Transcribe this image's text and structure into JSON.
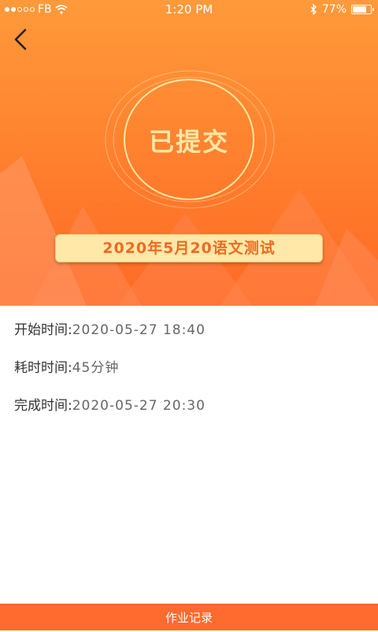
{
  "status_bar": {
    "carrier": "FB",
    "time": "1:20 PM",
    "battery": "77%",
    "battery_level": 0.77,
    "signal_bars": 2
  },
  "header": {
    "back_icon": "chevron-left-icon"
  },
  "submission": {
    "status": "已提交",
    "title": "2020年5月20语文测试"
  },
  "details": {
    "start_label": "开始时间:",
    "start_value": "2020-05-27 18:40",
    "duration_label": "耗时时间:",
    "duration_value": "45分钟",
    "finish_label": "完成时间:",
    "finish_value": "2020-05-27 20:30"
  },
  "footer": {
    "history_button": "作业记录"
  },
  "colors": {
    "accent": "#ff6a2e",
    "hero_top": "#ff9a3a",
    "badge_text": "#ffe7a6",
    "title_bg": "#ffe8a8",
    "title_text": "#f06a22"
  }
}
